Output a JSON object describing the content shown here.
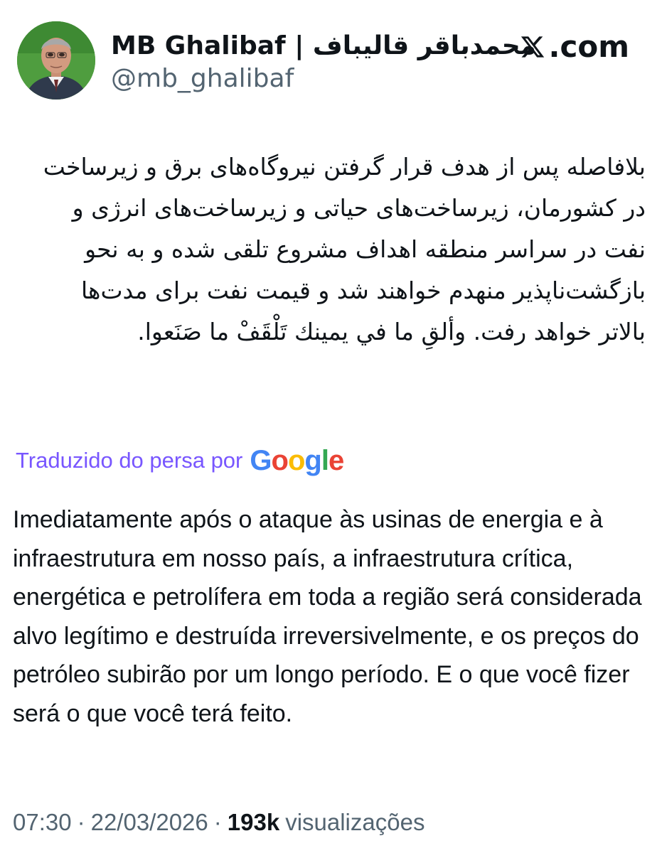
{
  "author": {
    "display_name": "MB Ghalibaf | محمدباقر قالیباف",
    "handle": "@mb_ghalibaf",
    "avatar_icon": "profile-photo"
  },
  "brand": {
    "text": ".com",
    "icon": "x-logo-icon"
  },
  "post": {
    "original_text": "بلافاصله پس از هدف قرار گرفتن نیروگاه‌های برق و زیرساخت در کشورمان، زیرساخت‌های حیاتی و زیرساخت‌های انرژی و نفت در سراسر منطقه اهداف مشروع تلقی شده و به نحو بازگشت‌ناپذیر منهدم خواهند شد و قیمت نفت برای مدت‌ها بالاتر خواهد رفت. وألقِ ما في يمينك تَلْقَفْ ما صَنَعوا.",
    "translation_label": "Traduzido do persa por",
    "translation_provider": "Google",
    "translated_text": "Imediatamente após o ataque às usinas de energia e à infraestrutura em nosso país, a infraestrutura crítica, energética e petrolífera em toda a região será considerada alvo legítimo e destruída irreversivelmente, e os preços do petróleo subirão por um longo período. E o que você fizer será o que você terá feito."
  },
  "meta": {
    "time": "07:30",
    "date": "22/03/2026",
    "separator": "·",
    "views_count": "193k",
    "views_label": "visualizações"
  },
  "colors": {
    "text": "#0f1419",
    "secondary": "#536471",
    "translation_link": "#7856ff",
    "avatar_background": "#4a9a3c"
  }
}
